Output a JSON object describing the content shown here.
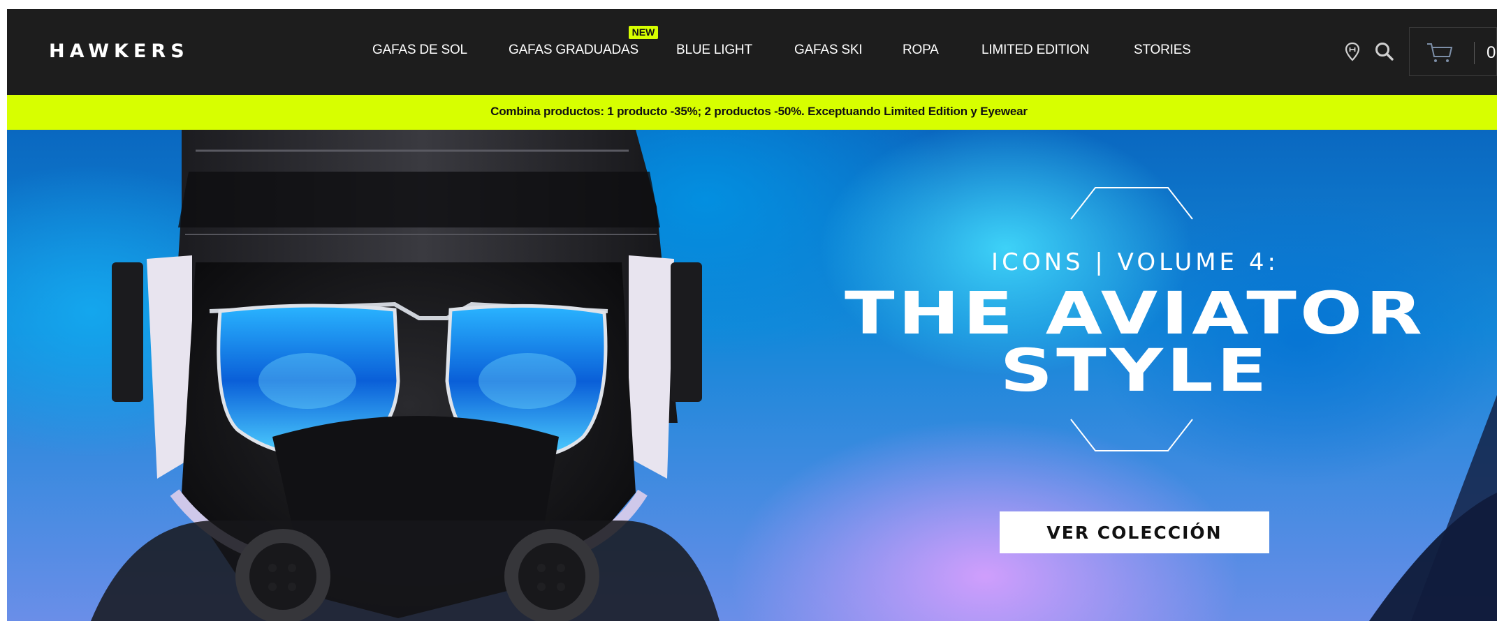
{
  "brand": {
    "logo_text": "HAWKERS"
  },
  "nav": {
    "items": [
      {
        "label": "GAFAS DE SOL"
      },
      {
        "label": "GAFAS GRADUADAS",
        "badge": "NEW"
      },
      {
        "label": "BLUE LIGHT"
      },
      {
        "label": "GAFAS SKI"
      },
      {
        "label": "ROPA"
      },
      {
        "label": "LIMITED EDITION"
      },
      {
        "label": "STORIES"
      }
    ]
  },
  "header_icons": {
    "store_locator": "map-pin-icon",
    "search": "search-icon",
    "cart": "cart-icon"
  },
  "cart": {
    "count": "0"
  },
  "promo": {
    "text": "Combina productos: 1 producto -35%; 2 productos -50%. Exceptuando Limited Edition y Eyewear"
  },
  "hero": {
    "subtitle": "ICONS | VOLUME 4:",
    "title_line1": "THE AVIATOR",
    "title_line2": "STYLE",
    "cta_label": "VER COLECCIÓN"
  },
  "colors": {
    "header_bg": "#1d1d1d",
    "accent_lime": "#d7ff00",
    "text_light": "#ffffff",
    "text_dark": "#111111"
  }
}
